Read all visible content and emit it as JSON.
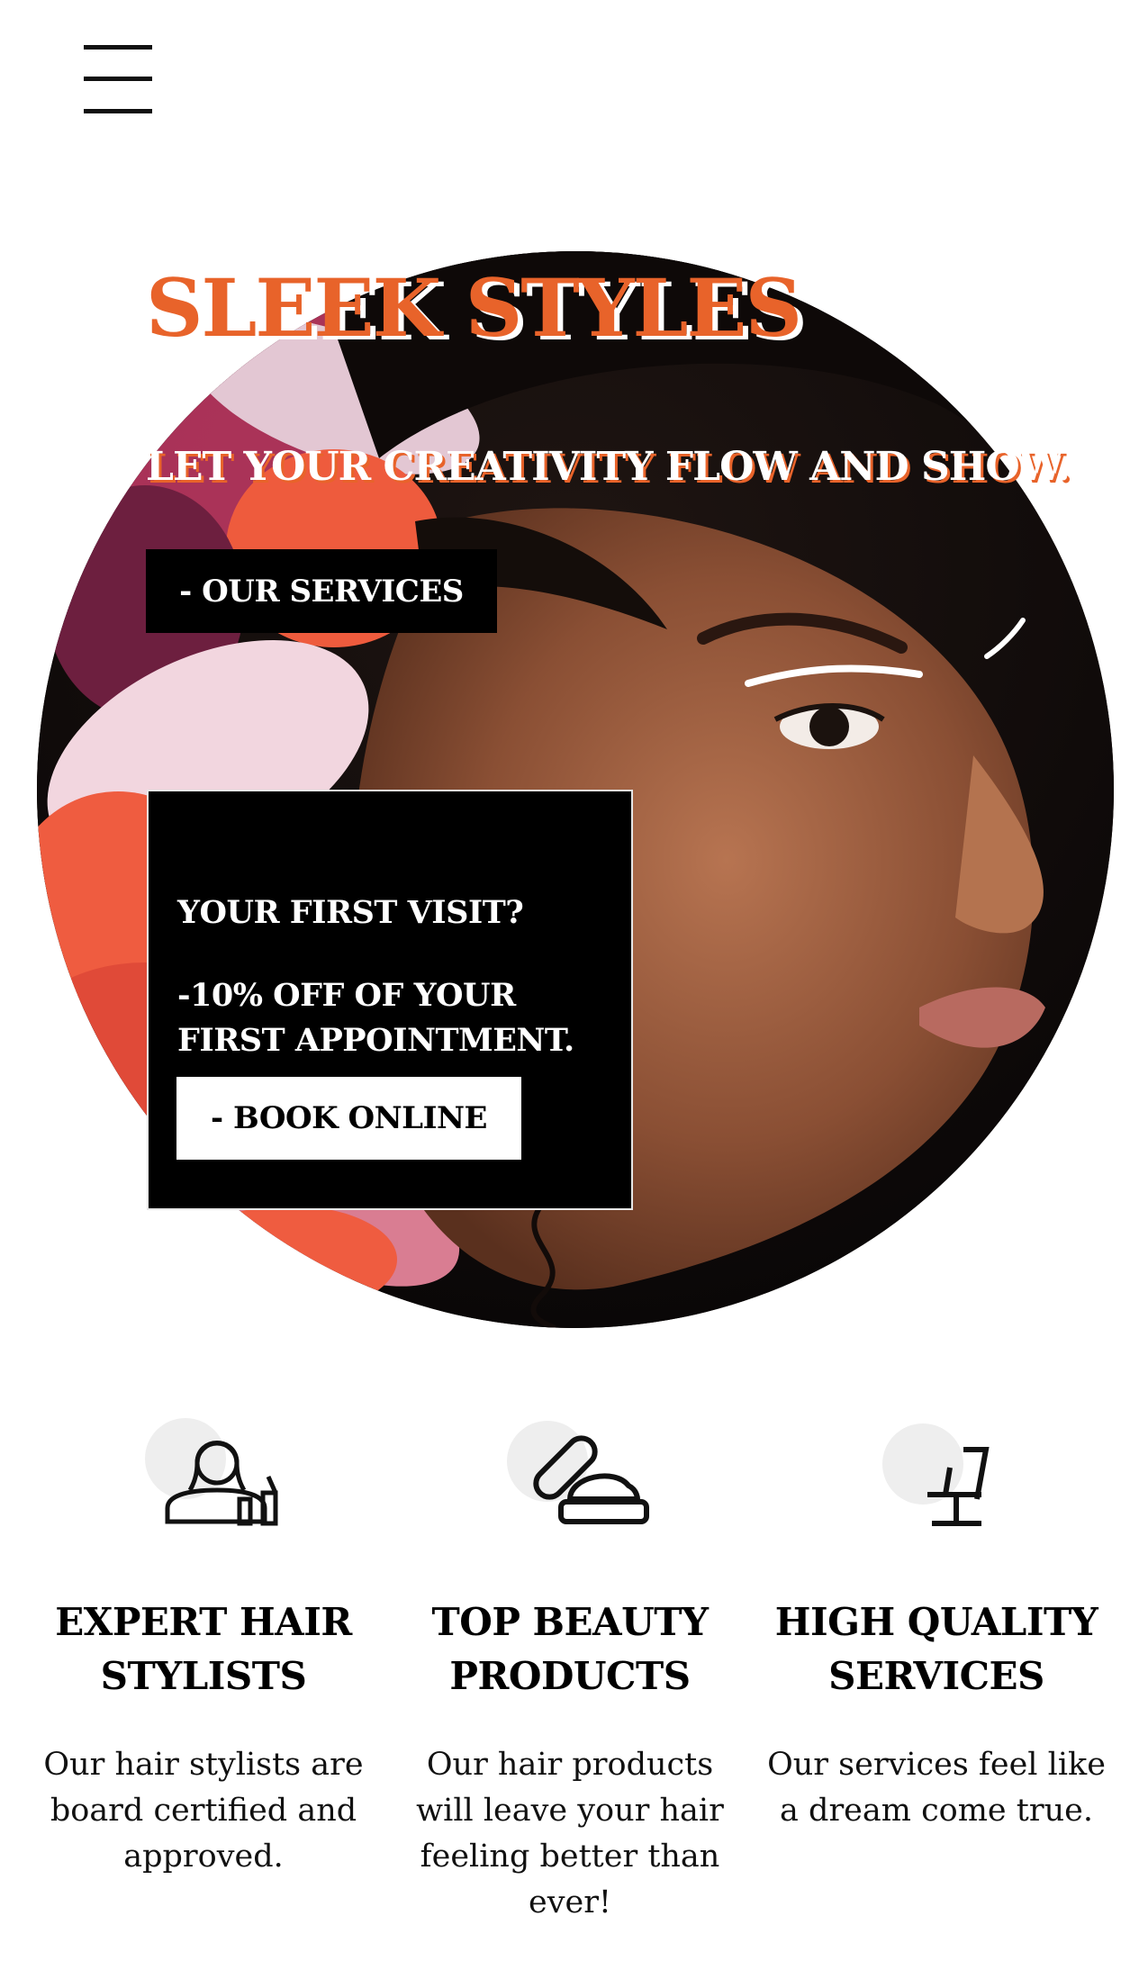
{
  "brand": {
    "title": "SLEEK STYLES",
    "tagline": "LET YOUR CREATIVITY FLOW AND SHOW."
  },
  "hero": {
    "services_button": "- OUR SERVICES"
  },
  "promo": {
    "title": "YOUR FIRST VISIT?",
    "text": "-10% OFF OF YOUR FIRST APPOINTMENT.",
    "book_button": "- BOOK ONLINE"
  },
  "features": [
    {
      "icon": "hair-stylist-icon",
      "title": "EXPERT HAIR STYLISTS",
      "description": "Our hair stylists are board certified and approved."
    },
    {
      "icon": "beauty-products-icon",
      "title": "TOP BEAUTY PRODUCTS",
      "description": "Our hair products will leave your hair feeling better than ever!"
    },
    {
      "icon": "salon-chair-icon",
      "title": "HIGH QUALITY SERVICES",
      "description": "Our services feel like a dream come true."
    }
  ],
  "colors": {
    "accent": "#e8632a",
    "button_dark": "#000000",
    "icon_circle": "#eeeeee"
  },
  "icons": {
    "menu": "hamburger-menu-icon"
  }
}
